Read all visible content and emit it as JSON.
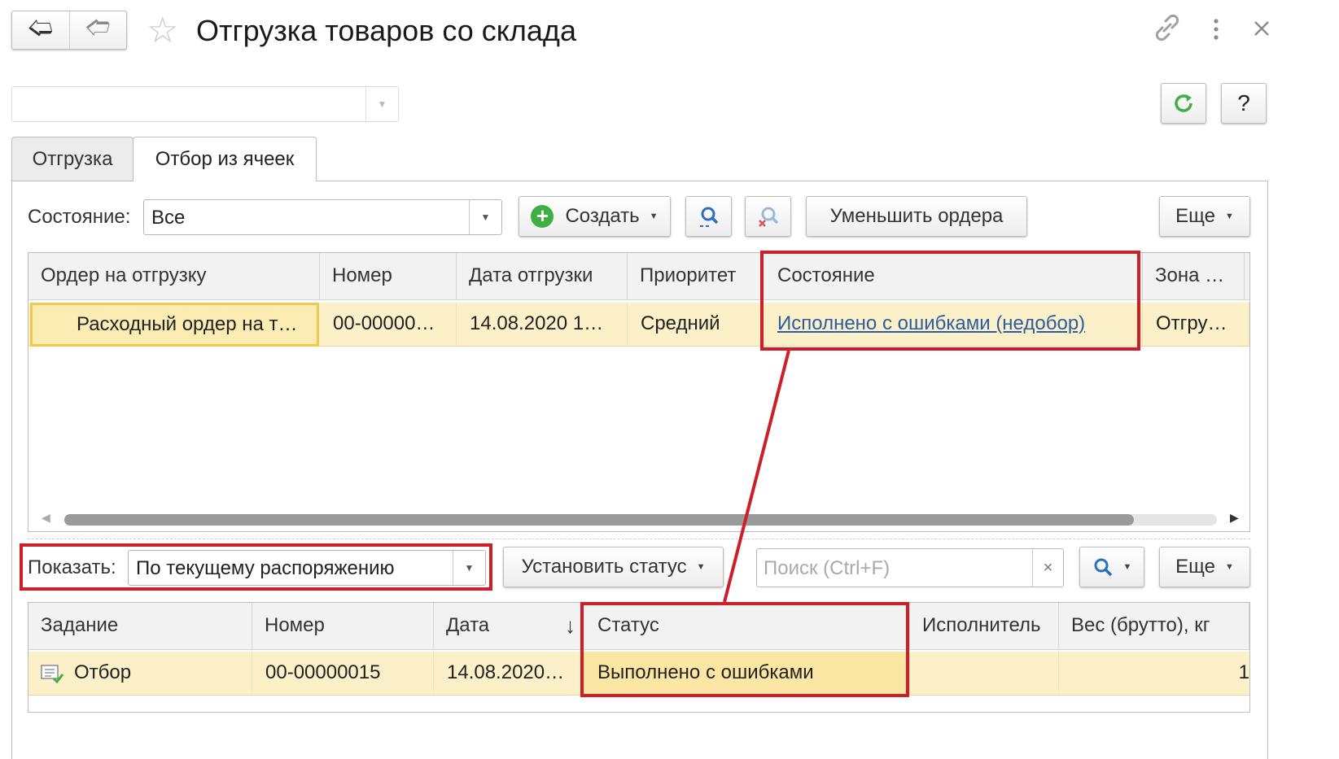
{
  "window": {
    "title": "Отгрузка товаров со склада",
    "back_icon": "arrow-left-icon",
    "forward_icon": "arrow-right-icon",
    "favorite_icon": "star-icon",
    "link_icon": "link-icon",
    "menu_icon": "more-vertical-icon",
    "close_icon": "close-icon"
  },
  "header_tools": {
    "refresh_icon": "refresh-icon",
    "help_label": "?",
    "refresh_color": "#3fae45"
  },
  "tabs": [
    {
      "label": "Отгрузка",
      "active": false
    },
    {
      "label": "Отбор из ячеек",
      "active": true
    }
  ],
  "orders_toolbar": {
    "state_label": "Состояние:",
    "state_value": "Все",
    "create_label": "Создать",
    "find_icon": "search-list-icon",
    "clear_find_icon": "search-clear-icon",
    "reduce_label": "Уменьшить ордера",
    "more_label": "Еще"
  },
  "orders_grid": {
    "columns": [
      "Ордер на отгрузку",
      "Номер",
      "Дата отгрузки",
      "Приоритет",
      "Состояние",
      "Зона …"
    ],
    "rows": [
      {
        "order": "Расходный ордер на т…",
        "number": "00-00000…",
        "date": "14.08.2020 1…",
        "priority": "Средний",
        "state": "Исполнено с ошибками (недобор)",
        "zone": "Отгру…"
      }
    ]
  },
  "tasks_toolbar": {
    "show_label": "Показать:",
    "show_value": "По текущему распоряжению",
    "set_status_label": "Установить статус",
    "search_placeholder": "Поиск (Ctrl+F)",
    "search_clear": "×",
    "search_icon": "search-icon",
    "more_label": "Еще"
  },
  "tasks_grid": {
    "columns": [
      "Задание",
      "Номер",
      "Дата",
      "Статус",
      "Исполнитель",
      "Вес (брутто), кг"
    ],
    "sort_indicator": "↓",
    "rows": [
      {
        "task": "Отбор",
        "task_icon": "task-done-icon",
        "number": "00-00000015",
        "date": "14.08.2020…",
        "status": "Выполнено с ошибками",
        "executor": "",
        "weight": "1"
      }
    ]
  },
  "colors": {
    "highlight_row": "#fbf0c8",
    "annotation_red": "#cc1f28",
    "link_blue": "#2a5da8"
  }
}
